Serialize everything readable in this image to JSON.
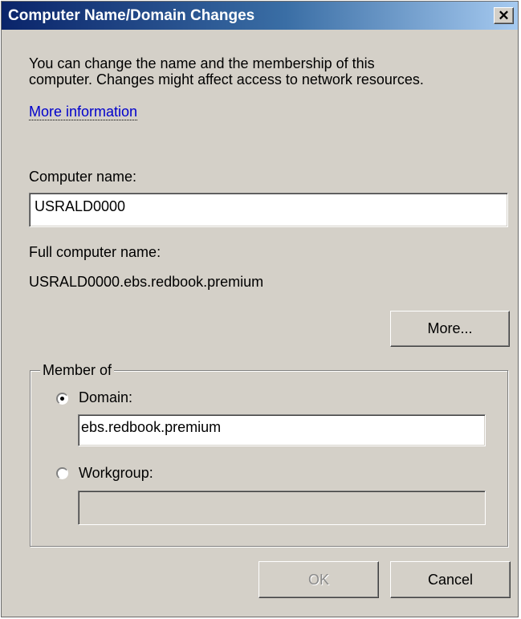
{
  "window": {
    "title": "Computer Name/Domain Changes",
    "close_glyph": "✕"
  },
  "description": {
    "line1": "You can change the name and the membership of this",
    "line2": "computer. Changes might affect access to network resources.",
    "more_info_link": "More information"
  },
  "computer_name": {
    "label": "Computer name:",
    "value": "USRALD0000"
  },
  "full_computer_name": {
    "label": "Full computer name:",
    "value": "USRALD0000.ebs.redbook.premium"
  },
  "more_button": "More...",
  "member_of": {
    "legend": "Member of",
    "domain": {
      "label": "Domain:",
      "selected": true,
      "value": "ebs.redbook.premium"
    },
    "workgroup": {
      "label": "Workgroup:",
      "selected": false,
      "value": ""
    }
  },
  "buttons": {
    "ok": "OK",
    "cancel": "Cancel"
  }
}
